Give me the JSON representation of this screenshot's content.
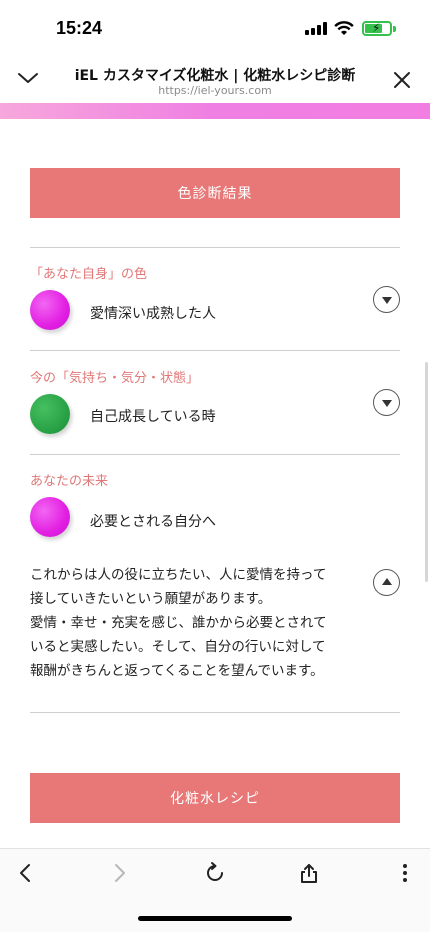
{
  "status_bar": {
    "time": "15:24"
  },
  "browser": {
    "title": "iEL カスタマイズ化粧水 | 化粧水レシピ診断",
    "url": "https://iel-yours.com"
  },
  "main": {
    "result_button": "色診断結果",
    "sections": [
      {
        "label": "「あなた自身」の色",
        "value": "愛情深い成熟した人",
        "circle_color": "#e21fe2",
        "toggle": "expand"
      },
      {
        "label": "今の「気持ち・気分・状態」",
        "value": "自己成長している時",
        "circle_color": "#2aa346",
        "toggle": "expand"
      },
      {
        "label": "あなたの未来",
        "value": "必要とされる自分へ",
        "circle_color": "#e21fe2",
        "toggle": "collapse"
      }
    ],
    "description_lines": [
      "これからは人の役に立ちたい、人に愛情を持って",
      "接していきたいという願望があります。",
      "愛情・幸せ・充実を感じ、誰かから必要とされて",
      "いると実感したい。そして、自分の行いに対して",
      "報酬がきちんと返ってくることを望んでいます。"
    ],
    "recipe_button": "化粧水レシピ"
  },
  "colors": {
    "accent": "#e87878",
    "label_text": "#e07878",
    "gradient": "#ef7fe3"
  },
  "toolbar": {
    "icons": [
      "back-icon",
      "forward-icon",
      "reload-icon",
      "share-icon",
      "more-icon"
    ]
  }
}
